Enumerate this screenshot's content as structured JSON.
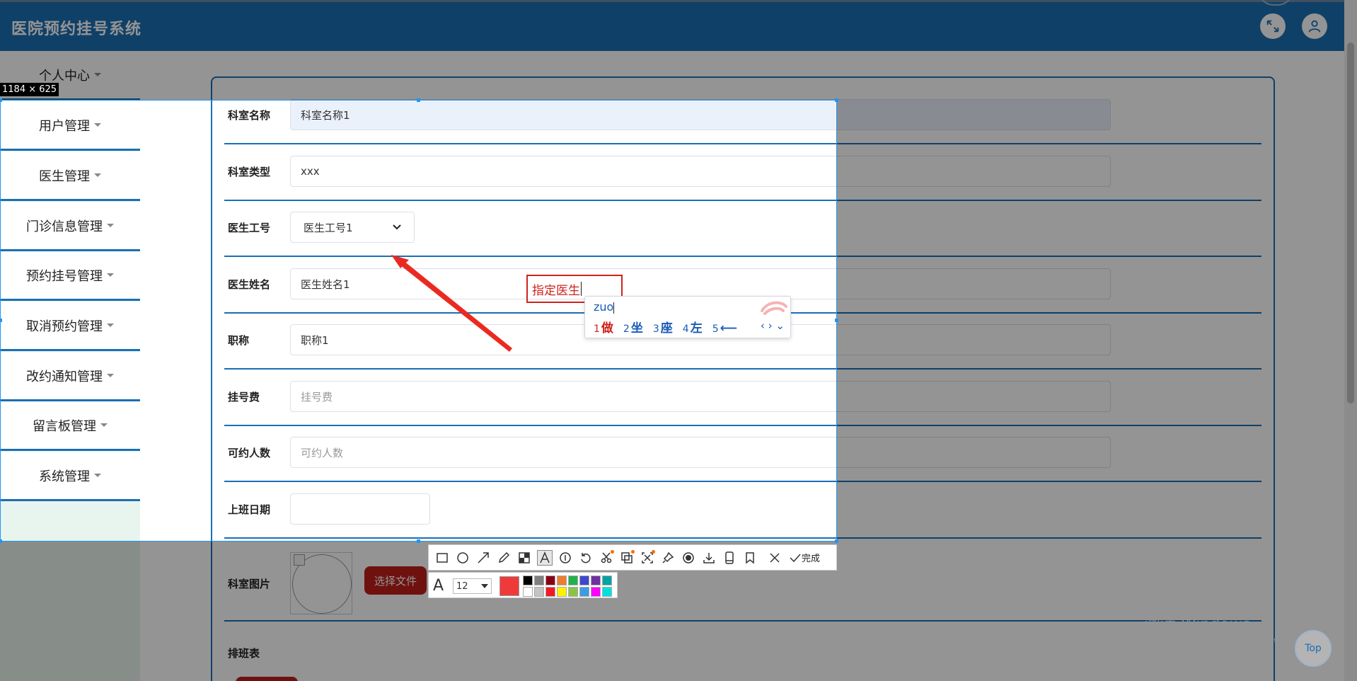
{
  "app": {
    "title": "医院预约挂号系统"
  },
  "sidebar": {
    "items": [
      {
        "label": "个人中心"
      },
      {
        "label": "用户管理"
      },
      {
        "label": "医生管理"
      },
      {
        "label": "门诊信息管理"
      },
      {
        "label": "预约挂号管理"
      },
      {
        "label": "取消预约管理"
      },
      {
        "label": "改约通知管理"
      },
      {
        "label": "留言板管理"
      },
      {
        "label": "系统管理"
      }
    ]
  },
  "form": {
    "dept_name": {
      "label": "科室名称",
      "value": "科室名称1"
    },
    "dept_type": {
      "label": "科室类型",
      "value": "xxx"
    },
    "doctor_no": {
      "label": "医生工号",
      "value": "医生工号1"
    },
    "doctor_name": {
      "label": "医生姓名",
      "value": "医生姓名1"
    },
    "title": {
      "label": "职称",
      "value": "职称1"
    },
    "fee": {
      "label": "挂号费",
      "placeholder": "挂号费"
    },
    "capacity": {
      "label": "可约人数",
      "placeholder": "可约人数"
    },
    "work_date": {
      "label": "上班日期",
      "value": ""
    },
    "dept_image": {
      "label": "科室图片",
      "button": "选择文件"
    },
    "schedule": {
      "label": "排班表"
    }
  },
  "capture": {
    "size_tip": "1184 × 625",
    "annotation_text": "指定医生",
    "annotation_color": "#d0221c",
    "font_size": "12",
    "done_label": "完成"
  },
  "ime": {
    "pinyin": "zuo",
    "candidates": [
      {
        "n": "1",
        "c": "做"
      },
      {
        "n": "2",
        "c": "坐"
      },
      {
        "n": "3",
        "c": "座"
      },
      {
        "n": "4",
        "c": "左"
      },
      {
        "n": "5",
        "c": "⟵"
      }
    ],
    "nav": "‹ › ⌄"
  },
  "palette": [
    "#000000",
    "#7f7f7f",
    "#880015",
    "#ed7d31",
    "#22b14c",
    "#3f48cc",
    "#7030a0",
    "#00a2a2",
    "#ffffff",
    "#c3c3c3",
    "#ed1c24",
    "#fff200",
    "#8bc34a",
    "#3f9be0",
    "#ff00ff",
    "#00e0e0"
  ],
  "watermark": {
    "line1": "激活 Windows",
    "line2": "转到\"设置\"以激活 Windows。"
  },
  "top_button": "Top",
  "colors": {
    "header": "#1a6fb4",
    "accent": "#1a6fb4",
    "danger": "#c0201a"
  }
}
